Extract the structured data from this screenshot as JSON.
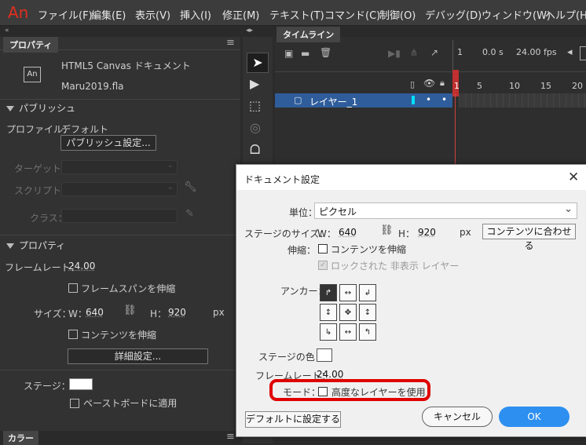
{
  "menubar": {
    "logo": "An",
    "items": [
      "ファイル(F)",
      "編集(E)",
      "表示(V)",
      "挿入(I)",
      "修正(M)",
      "テキスト(T)",
      "コマンド(C)",
      "制御(O)",
      "デバッグ(D)",
      "ウィンドウ(W)",
      "ヘルプ(H)"
    ]
  },
  "properties": {
    "tab": "プロパティ",
    "doc_icon": "An",
    "doc_type": "HTML5 Canvas ドキュメント",
    "doc_name": "Maru2019.fla",
    "publish": {
      "header": "パブリッシュ",
      "profile_label": "プロファイル：",
      "profile_value": "デフォルト",
      "settings_button": "パブリッシュ設定...",
      "target_label": "ターゲット：",
      "script_label": "スクリプト：",
      "class_label": "クラス："
    },
    "props": {
      "header": "プロパティ",
      "framerate_label": "フレームレート：",
      "framerate_value": "24.00",
      "scale_spans": "フレームスパンを伸縮",
      "size_label": "サイズ：",
      "w_label": "W：",
      "w_value": "640",
      "h_label": "H：",
      "h_value": "920",
      "unit": "px",
      "scale_content": "コンテンツを伸縮",
      "advanced_button": "詳細設定...",
      "stage_label": "ステージ：",
      "stage_color": "#ffffff",
      "pasteboard": "ペーストボードに適用"
    },
    "color_tab": "カラー"
  },
  "timeline": {
    "tab": "タイムライン",
    "frame": "1",
    "time": "0.0 s",
    "fps": "24.00 fps",
    "ruler": [
      "1",
      "5",
      "10",
      "15",
      "20"
    ],
    "layer_name": "レイヤー_1"
  },
  "dialog": {
    "title": "ドキュメント設定",
    "unit_label": "単位：",
    "unit_value": "ピクセル",
    "stage_size_label": "ステージのサイズ：",
    "w_label": "W：",
    "w_value": "640",
    "h_label": "H：",
    "h_value": "920",
    "px": "px",
    "fit_button": "コンテンツに合わせる",
    "scale_label": "伸縮：",
    "scale_content": "コンテンツを伸縮",
    "locked_hidden": "ロックされた 非表示 レイヤー",
    "anchor_label": "アンカー：",
    "stage_color_label": "ステージの色：",
    "stage_color": "#ffffff",
    "framerate_label": "フレームレート：",
    "framerate_value": "24.00",
    "mode_label": "モード：",
    "advanced_layers": "高度なレイヤーを使用",
    "default_button": "デフォルトに設定する",
    "cancel_button": "キャンセル",
    "ok_button": "OK",
    "highlight_color": "#e00000",
    "ok_color": "#2d8ff0"
  }
}
